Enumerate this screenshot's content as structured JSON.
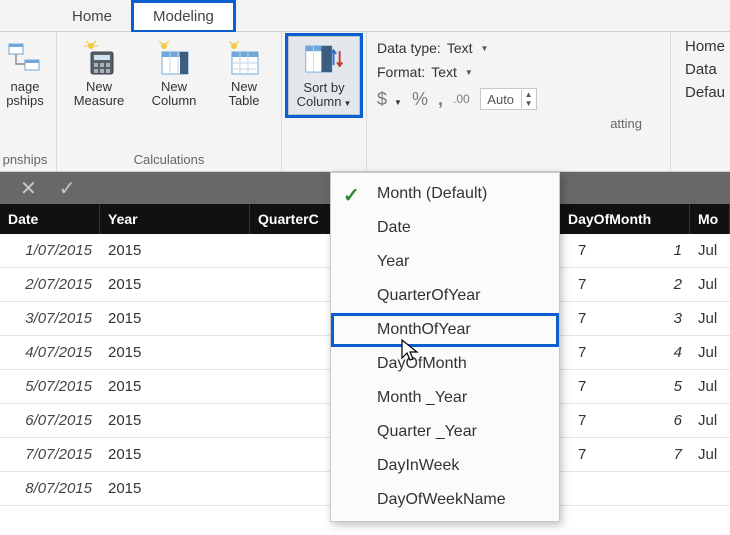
{
  "tabs": {
    "home": "Home",
    "modeling": "Modeling"
  },
  "ribbon": {
    "relationships": {
      "btn": "nage\npships",
      "group": "pnships"
    },
    "calculations": {
      "measure": "New\nMeasure",
      "column": "New\nColumn",
      "table": "New\nTable",
      "group": "Calculations"
    },
    "sort": {
      "btn": "Sort by\nColumn"
    },
    "formatting": {
      "datatype_label": "Data type:",
      "datatype_value": "Text",
      "format_label": "Format:",
      "format_value": "Text",
      "currency": "$",
      "percent": "%",
      "comma": ",",
      "decimals_icon": ".00",
      "decimals_value": "Auto",
      "group": "atting"
    },
    "properties": {
      "l1": "Home",
      "l2": "Data",
      "l3": "Defau"
    }
  },
  "grid": {
    "headers": {
      "date": "Date",
      "year": "Year",
      "quarter": "QuarterC",
      "daym": "DayOfMonth",
      "month": "Mo"
    },
    "rows": [
      {
        "date": "1/07/2015",
        "year": "2015",
        "dayn": "7",
        "daym": "1",
        "mon": "Jul"
      },
      {
        "date": "2/07/2015",
        "year": "2015",
        "dayn": "7",
        "daym": "2",
        "mon": "Jul"
      },
      {
        "date": "3/07/2015",
        "year": "2015",
        "dayn": "7",
        "daym": "3",
        "mon": "Jul"
      },
      {
        "date": "4/07/2015",
        "year": "2015",
        "dayn": "7",
        "daym": "4",
        "mon": "Jul"
      },
      {
        "date": "5/07/2015",
        "year": "2015",
        "dayn": "7",
        "daym": "5",
        "mon": "Jul"
      },
      {
        "date": "6/07/2015",
        "year": "2015",
        "dayn": "7",
        "daym": "6",
        "mon": "Jul"
      },
      {
        "date": "7/07/2015",
        "year": "2015",
        "dayn": "7",
        "daym": "7",
        "mon": "Jul"
      },
      {
        "date": "8/07/2015",
        "year": "2015",
        "dayn": "",
        "daym": "",
        "mon": ""
      }
    ]
  },
  "menu": {
    "items": [
      "Month (Default)",
      "Date",
      "Year",
      "QuarterOfYear",
      "MonthOfYear",
      "DayOfMonth",
      "Month _Year",
      "Quarter _Year",
      "DayInWeek",
      "DayOfWeekName"
    ]
  }
}
